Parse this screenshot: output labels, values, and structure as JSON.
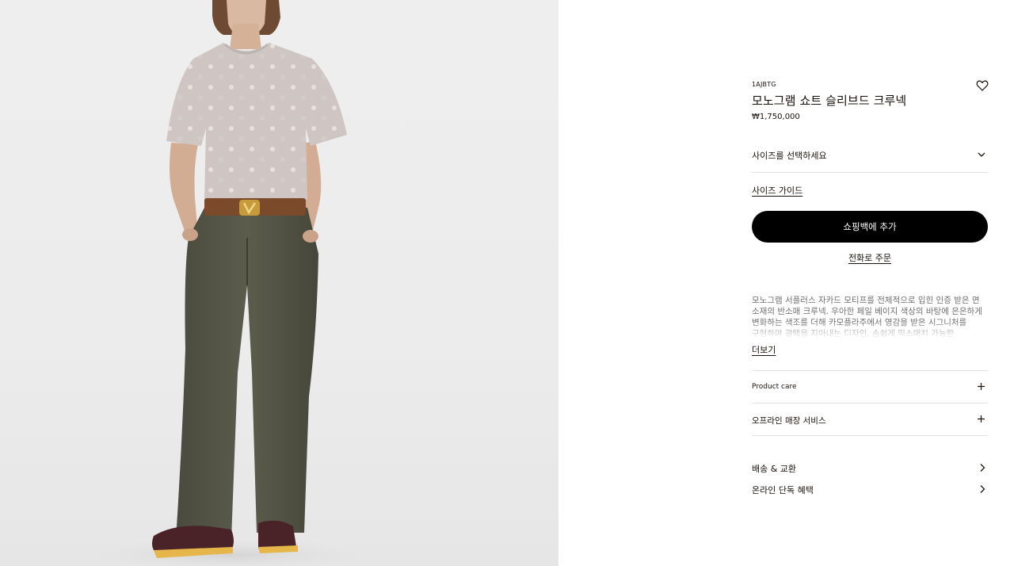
{
  "product": {
    "sku": "1AJBTG",
    "name": "모노그램 쇼트 슬리브드 크루넥",
    "price": "₩1,750,000"
  },
  "size_select": {
    "placeholder": "사이즈를 선택하세요"
  },
  "size_guide_label": "사이즈 가이드",
  "add_to_bag_label": "쇼핑백에 추가",
  "order_by_phone_label": "전화로 주문",
  "description": "모노그램 서플러스 자카드 모티프를 전체적으로 입힌 인증 받은 면 소재의 반소매 크루넥. 우아한 페일 베이지 색상의 바탕에 은은하게 변화하는 색조를 더해 카모플라주에서 영감을 받은 시그니처를 구현하며 광택을 지아내는 디자인, 손쉽게 믹스매치 가능한",
  "read_more_label": "더보기",
  "accordion": [
    {
      "label": "Product care"
    },
    {
      "label": "오프라인 매장 서비스"
    }
  ],
  "links": [
    {
      "label": "배송 & 교환"
    },
    {
      "label": "온라인 단독 혜택"
    }
  ],
  "icons": {
    "wishlist": "heart-outline-icon",
    "size_dropdown": "chevron-down-icon",
    "expand": "plus-icon",
    "navigate": "chevron-right-icon"
  },
  "colors": {
    "primary_button": "#000000",
    "text": "#19110b",
    "divider": "#e1e1e1",
    "image_background": "#eeeeee"
  }
}
